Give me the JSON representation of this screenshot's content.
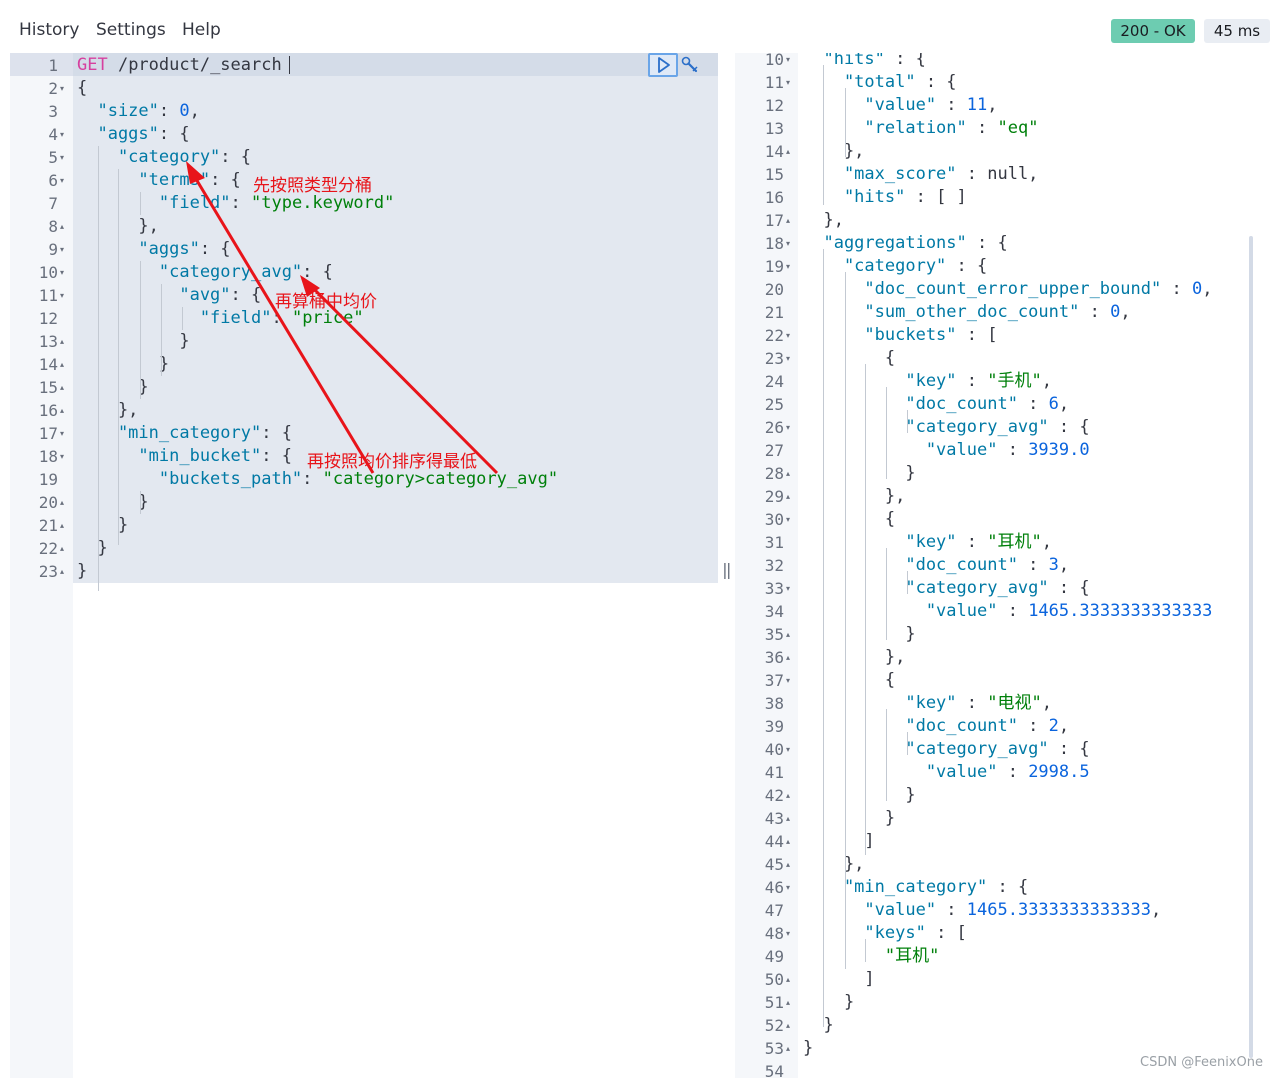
{
  "menu": {
    "history": "History",
    "settings": "Settings",
    "help": "Help"
  },
  "status": {
    "code_text": "200 - OK",
    "time_text": "45 ms",
    "ok_color": "#6dccb1"
  },
  "request": {
    "method": "GET",
    "path": "/product/_search",
    "lines": [
      [
        {
          "t": "m",
          "v": "GET "
        },
        {
          "t": "u",
          "v": "/product/_search"
        }
      ],
      [
        {
          "t": "p",
          "v": "{"
        }
      ],
      [
        {
          "t": "k",
          "v": "  \"size\""
        },
        {
          "t": "p",
          "v": ": "
        },
        {
          "t": "n",
          "v": "0"
        },
        {
          "t": "p",
          "v": ","
        }
      ],
      [
        {
          "t": "k",
          "v": "  \"aggs\""
        },
        {
          "t": "p",
          "v": ": {"
        }
      ],
      [
        {
          "t": "k",
          "v": "    \"category\""
        },
        {
          "t": "p",
          "v": ": {"
        }
      ],
      [
        {
          "t": "k",
          "v": "      \"terms\""
        },
        {
          "t": "p",
          "v": ": {"
        }
      ],
      [
        {
          "t": "k",
          "v": "        \"field\""
        },
        {
          "t": "p",
          "v": ": "
        },
        {
          "t": "s",
          "v": "\"type.keyword\""
        }
      ],
      [
        {
          "t": "p",
          "v": "      },"
        }
      ],
      [
        {
          "t": "k",
          "v": "      \"aggs\""
        },
        {
          "t": "p",
          "v": ": {"
        }
      ],
      [
        {
          "t": "k",
          "v": "        \"category_avg\""
        },
        {
          "t": "p",
          "v": ": {"
        }
      ],
      [
        {
          "t": "k",
          "v": "          \"avg\""
        },
        {
          "t": "p",
          "v": ": {"
        }
      ],
      [
        {
          "t": "k",
          "v": "            \"field\""
        },
        {
          "t": "p",
          "v": ": "
        },
        {
          "t": "s",
          "v": "\"price\""
        }
      ],
      [
        {
          "t": "p",
          "v": "          }"
        }
      ],
      [
        {
          "t": "p",
          "v": "        }"
        }
      ],
      [
        {
          "t": "p",
          "v": "      }"
        }
      ],
      [
        {
          "t": "p",
          "v": "    },"
        }
      ],
      [
        {
          "t": "k",
          "v": "    \"min_category\""
        },
        {
          "t": "p",
          "v": ": {"
        }
      ],
      [
        {
          "t": "k",
          "v": "      \"min_bucket\""
        },
        {
          "t": "p",
          "v": ": {"
        }
      ],
      [
        {
          "t": "k",
          "v": "        \"buckets_path\""
        },
        {
          "t": "p",
          "v": ": "
        },
        {
          "t": "s",
          "v": "\"category>category_avg\""
        }
      ],
      [
        {
          "t": "p",
          "v": "      }"
        }
      ],
      [
        {
          "t": "p",
          "v": "    }"
        }
      ],
      [
        {
          "t": "p",
          "v": "  }"
        }
      ],
      [
        {
          "t": "p",
          "v": "}"
        }
      ]
    ],
    "line_numbers": [
      "1",
      "2",
      "3",
      "4",
      "5",
      "6",
      "7",
      "8",
      "9",
      "10",
      "11",
      "12",
      "13",
      "14",
      "15",
      "16",
      "17",
      "18",
      "19",
      "20",
      "21",
      "22",
      "23"
    ],
    "folds": [
      "",
      "▾",
      "",
      "▾",
      "▾",
      "▾",
      "",
      "▴",
      "▾",
      "▾",
      "▾",
      "",
      "▴",
      "▴",
      "▴",
      "▴",
      "▾",
      "▾",
      "",
      "▴",
      "▴",
      "▴",
      "▴"
    ]
  },
  "response": {
    "lines": [
      [
        {
          "t": "k",
          "v": "  \"hits\""
        },
        {
          "t": "p",
          "v": " : {"
        }
      ],
      [
        {
          "t": "k",
          "v": "    \"total\""
        },
        {
          "t": "p",
          "v": " : {"
        }
      ],
      [
        {
          "t": "k",
          "v": "      \"value\""
        },
        {
          "t": "p",
          "v": " : "
        },
        {
          "t": "n",
          "v": "11"
        },
        {
          "t": "p",
          "v": ","
        }
      ],
      [
        {
          "t": "k",
          "v": "      \"relation\""
        },
        {
          "t": "p",
          "v": " : "
        },
        {
          "t": "s",
          "v": "\"eq\""
        }
      ],
      [
        {
          "t": "p",
          "v": "    },"
        }
      ],
      [
        {
          "t": "k",
          "v": "    \"max_score\""
        },
        {
          "t": "p",
          "v": " : null,"
        }
      ],
      [
        {
          "t": "k",
          "v": "    \"hits\""
        },
        {
          "t": "p",
          "v": " : [ ]"
        }
      ],
      [
        {
          "t": "p",
          "v": "  },"
        }
      ],
      [
        {
          "t": "k",
          "v": "  \"aggregations\""
        },
        {
          "t": "p",
          "v": " : {"
        }
      ],
      [
        {
          "t": "k",
          "v": "    \"category\""
        },
        {
          "t": "p",
          "v": " : {"
        }
      ],
      [
        {
          "t": "k",
          "v": "      \"doc_count_error_upper_bound\""
        },
        {
          "t": "p",
          "v": " : "
        },
        {
          "t": "n",
          "v": "0"
        },
        {
          "t": "p",
          "v": ","
        }
      ],
      [
        {
          "t": "k",
          "v": "      \"sum_other_doc_count\""
        },
        {
          "t": "p",
          "v": " : "
        },
        {
          "t": "n",
          "v": "0"
        },
        {
          "t": "p",
          "v": ","
        }
      ],
      [
        {
          "t": "k",
          "v": "      \"buckets\""
        },
        {
          "t": "p",
          "v": " : ["
        }
      ],
      [
        {
          "t": "p",
          "v": "        {"
        }
      ],
      [
        {
          "t": "k",
          "v": "          \"key\""
        },
        {
          "t": "p",
          "v": " : "
        },
        {
          "t": "s",
          "v": "\"手机\""
        },
        {
          "t": "p",
          "v": ","
        }
      ],
      [
        {
          "t": "k",
          "v": "          \"doc_count\""
        },
        {
          "t": "p",
          "v": " : "
        },
        {
          "t": "n",
          "v": "6"
        },
        {
          "t": "p",
          "v": ","
        }
      ],
      [
        {
          "t": "k",
          "v": "          \"category_avg\""
        },
        {
          "t": "p",
          "v": " : {"
        }
      ],
      [
        {
          "t": "k",
          "v": "            \"value\""
        },
        {
          "t": "p",
          "v": " : "
        },
        {
          "t": "n",
          "v": "3939.0"
        }
      ],
      [
        {
          "t": "p",
          "v": "          }"
        }
      ],
      [
        {
          "t": "p",
          "v": "        },"
        }
      ],
      [
        {
          "t": "p",
          "v": "        {"
        }
      ],
      [
        {
          "t": "k",
          "v": "          \"key\""
        },
        {
          "t": "p",
          "v": " : "
        },
        {
          "t": "s",
          "v": "\"耳机\""
        },
        {
          "t": "p",
          "v": ","
        }
      ],
      [
        {
          "t": "k",
          "v": "          \"doc_count\""
        },
        {
          "t": "p",
          "v": " : "
        },
        {
          "t": "n",
          "v": "3"
        },
        {
          "t": "p",
          "v": ","
        }
      ],
      [
        {
          "t": "k",
          "v": "          \"category_avg\""
        },
        {
          "t": "p",
          "v": " : {"
        }
      ],
      [
        {
          "t": "k",
          "v": "            \"value\""
        },
        {
          "t": "p",
          "v": " : "
        },
        {
          "t": "n",
          "v": "1465.3333333333333"
        }
      ],
      [
        {
          "t": "p",
          "v": "          }"
        }
      ],
      [
        {
          "t": "p",
          "v": "        },"
        }
      ],
      [
        {
          "t": "p",
          "v": "        {"
        }
      ],
      [
        {
          "t": "k",
          "v": "          \"key\""
        },
        {
          "t": "p",
          "v": " : "
        },
        {
          "t": "s",
          "v": "\"电视\""
        },
        {
          "t": "p",
          "v": ","
        }
      ],
      [
        {
          "t": "k",
          "v": "          \"doc_count\""
        },
        {
          "t": "p",
          "v": " : "
        },
        {
          "t": "n",
          "v": "2"
        },
        {
          "t": "p",
          "v": ","
        }
      ],
      [
        {
          "t": "k",
          "v": "          \"category_avg\""
        },
        {
          "t": "p",
          "v": " : {"
        }
      ],
      [
        {
          "t": "k",
          "v": "            \"value\""
        },
        {
          "t": "p",
          "v": " : "
        },
        {
          "t": "n",
          "v": "2998.5"
        }
      ],
      [
        {
          "t": "p",
          "v": "          }"
        }
      ],
      [
        {
          "t": "p",
          "v": "        }"
        }
      ],
      [
        {
          "t": "p",
          "v": "      ]"
        }
      ],
      [
        {
          "t": "p",
          "v": "    },"
        }
      ],
      [
        {
          "t": "k",
          "v": "    \"min_category\""
        },
        {
          "t": "p",
          "v": " : {"
        }
      ],
      [
        {
          "t": "k",
          "v": "      \"value\""
        },
        {
          "t": "p",
          "v": " : "
        },
        {
          "t": "n",
          "v": "1465.3333333333333"
        },
        {
          "t": "p",
          "v": ","
        }
      ],
      [
        {
          "t": "k",
          "v": "      \"keys\""
        },
        {
          "t": "p",
          "v": " : ["
        }
      ],
      [
        {
          "t": "s",
          "v": "        \"耳机\""
        }
      ],
      [
        {
          "t": "p",
          "v": "      ]"
        }
      ],
      [
        {
          "t": "p",
          "v": "    }"
        }
      ],
      [
        {
          "t": "p",
          "v": "  }"
        }
      ],
      [
        {
          "t": "p",
          "v": "}"
        }
      ],
      [
        {
          "t": "p",
          "v": ""
        }
      ]
    ],
    "line_numbers": [
      "10",
      "11",
      "12",
      "13",
      "14",
      "15",
      "16",
      "17",
      "18",
      "19",
      "20",
      "21",
      "22",
      "23",
      "24",
      "25",
      "26",
      "27",
      "28",
      "29",
      "30",
      "31",
      "32",
      "33",
      "34",
      "35",
      "36",
      "37",
      "38",
      "39",
      "40",
      "41",
      "42",
      "43",
      "44",
      "45",
      "46",
      "47",
      "48",
      "49",
      "50",
      "51",
      "52",
      "53",
      "54"
    ],
    "folds": [
      "▾",
      "▾",
      "",
      "",
      "▴",
      "",
      "",
      "▴",
      "▾",
      "▾",
      "",
      "",
      "▾",
      "▾",
      "",
      "",
      "▾",
      "",
      "▴",
      "▴",
      "▾",
      "",
      "",
      "▾",
      "",
      "▴",
      "▴",
      "▾",
      "",
      "",
      "▾",
      "",
      "▴",
      "▴",
      "▴",
      "▴",
      "▾",
      "",
      "▾",
      "",
      "▴",
      "▴",
      "▴",
      "▴",
      ""
    ]
  },
  "annotations": {
    "note1": "先按照类型分桶",
    "note2": "再算桶中均价",
    "note3": "再按照均价排序得最低",
    "arrow_color": "#e8141a"
  },
  "watermark": "CSDN @FeenixOne"
}
